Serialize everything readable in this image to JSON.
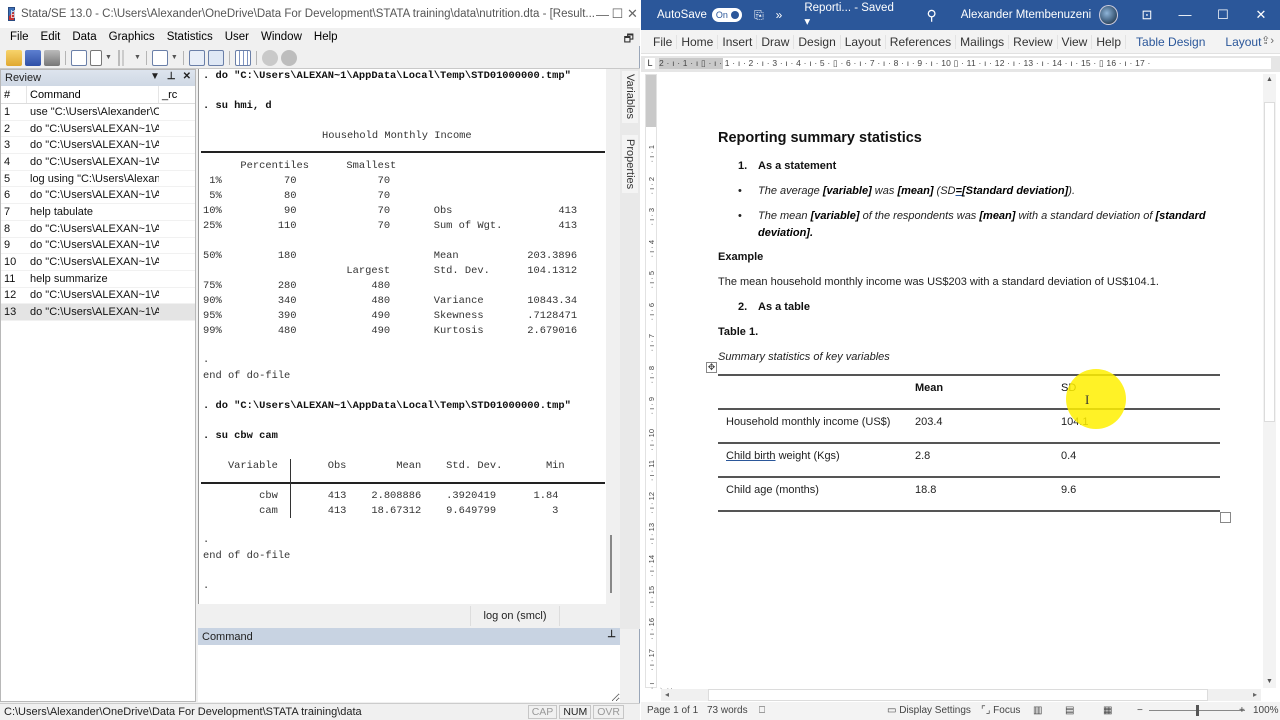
{
  "stata": {
    "title": "Stata/SE 13.0 - C:\\Users\\Alexander\\OneDrive\\Data For Development\\STATA training\\data\\nutrition.dta - [Result...",
    "window_controls": {
      "minimize": "—",
      "maximize": "☐",
      "close": "✕"
    },
    "menu": [
      "File",
      "Edit",
      "Data",
      "Graphics",
      "Statistics",
      "User",
      "Window",
      "Help"
    ],
    "toolbar_icons": [
      "open-icon",
      "save-icon",
      "print-icon",
      "log-icon",
      "viewer-icon",
      "graph-icon",
      "do-file-editor-icon",
      "data-editor-icon",
      "data-browser-icon",
      "variables-manager-icon",
      "more-icon",
      "break-icon"
    ],
    "review": {
      "title": "Review",
      "columns": [
        "#",
        "Command",
        "_rc"
      ],
      "rows": [
        {
          "n": "1",
          "cmd": "use \"C:\\Users\\Alexander\\O..."
        },
        {
          "n": "2",
          "cmd": "do \"C:\\Users\\ALEXAN~1\\A..."
        },
        {
          "n": "3",
          "cmd": "do \"C:\\Users\\ALEXAN~1\\A..."
        },
        {
          "n": "4",
          "cmd": "do \"C:\\Users\\ALEXAN~1\\A..."
        },
        {
          "n": "5",
          "cmd": "log using \"C:\\Users\\Alexan..."
        },
        {
          "n": "6",
          "cmd": "do \"C:\\Users\\ALEXAN~1\\A..."
        },
        {
          "n": "7",
          "cmd": "help tabulate"
        },
        {
          "n": "8",
          "cmd": "do \"C:\\Users\\ALEXAN~1\\A..."
        },
        {
          "n": "9",
          "cmd": "do \"C:\\Users\\ALEXAN~1\\A..."
        },
        {
          "n": "10",
          "cmd": "do \"C:\\Users\\ALEXAN~1\\A..."
        },
        {
          "n": "11",
          "cmd": "help summarize"
        },
        {
          "n": "12",
          "cmd": "do \"C:\\Users\\ALEXAN~1\\A..."
        },
        {
          "n": "13",
          "cmd": "do \"C:\\Users\\ALEXAN~1\\A..."
        }
      ],
      "selected_row": "13"
    },
    "results": {
      "cmd1": ". do \"C:\\Users\\ALEXAN~1\\AppData\\Local\\Temp\\STD01000000.tmp\"",
      "cmd2": ". su hmi, d",
      "hmi_title": "Household Monthly Income",
      "hmi_header": "      Percentiles      Smallest",
      "hmi_rows": [
        " 1%          70             70",
        " 5%          80             70",
        "10%          90             70       Obs                 413",
        "25%         110             70       Sum of Wgt.         413",
        "",
        "50%         180                      Mean           203.3896",
        "                       Largest       Std. Dev.      104.1312",
        "75%         280            480",
        "90%         340            480       Variance       10843.34",
        "95%         390            490       Skewness       .7128471",
        "99%         480            490       Kurtosis       2.679016"
      ],
      "dot": ".",
      "end": "end of do-file",
      "cmd3": ". do \"C:\\Users\\ALEXAN~1\\AppData\\Local\\Temp\\STD01000000.tmp\"",
      "cmd4": ". su cbw cam",
      "su_header": "    Variable        Obs        Mean    Std. Dev.       Min",
      "su_rows": [
        "         cbw        413    2.808886    .3920419      1.84",
        "         cam        413    18.67312    9.649799         3"
      ],
      "dot2": ".",
      "end2": "end of do-file",
      "prompt": "."
    },
    "side_tabs": [
      "Variables",
      "Properties"
    ],
    "log_status": "log on (smcl)",
    "command_panel": {
      "title": "Command",
      "value": ""
    },
    "status_path": "C:\\Users\\Alexander\\OneDrive\\Data For Development\\STATA training\\data",
    "keys": [
      {
        "label": "CAP",
        "on": false
      },
      {
        "label": "NUM",
        "on": true
      },
      {
        "label": "OVR",
        "on": false
      }
    ]
  },
  "word": {
    "autosave_label": "AutoSave",
    "autosave_state": "On",
    "doc_title": "Reporti...  - Saved",
    "user": "Alexander Mtembenuzeni",
    "window_controls": {
      "ribbon_display": "⊡",
      "minimize": "—",
      "maximize": "☐",
      "close": "✕"
    },
    "ribbon_tabs": [
      "File",
      "Home",
      "Insert",
      "Draw",
      "Design",
      "Layout",
      "References",
      "Mailings",
      "Review",
      "View",
      "Help"
    ],
    "context_tabs": [
      "Table Design",
      "Layout"
    ],
    "ruler_ticks": "2 · ı · 1 · ı ▯ · ı · 1 · ı · 2 · ı · 3 · ı · 4 · ı · 5 · ▯ · 6 · ı · 7 · ı · 8 · ı · 9 · ı · 10 ▯ · 11 · ı · 12 · ı · 13 · ı · 14 · ı · 15 · ▯ 16 · ı · 17 ·",
    "document": {
      "heading": "Reporting summary statistics",
      "list1_num": "1.",
      "list1": "As a statement",
      "bullet1": {
        "a": "The average ",
        "b": "[variable]",
        "c": " was ",
        "d": "[mean]",
        "e": " (SD",
        "f": "=",
        "g": "[Standard deviation]",
        "h": ")."
      },
      "bullet2": {
        "a": "The mean ",
        "b": "[variable]",
        "c": " of the respondents was ",
        "d": "[mean]",
        "e": " with a standard deviation of ",
        "f": "[standard deviation]."
      },
      "example_label": "Example",
      "example_text": "The mean household monthly income was US$203 with a standard deviation of US$104.1.",
      "list2_num": "2.",
      "list2": "As a table",
      "table_label": "Table 1.",
      "table_caption": "Summary statistics of key variables",
      "table": {
        "headers": [
          "",
          "Mean",
          "SD"
        ],
        "rows": [
          {
            "var": "Household monthly income (US$)",
            "mean": "203.4",
            "sd": "104.1"
          },
          {
            "var_a": "Child birth",
            "var_b": " weight (Kgs)",
            "mean": "2.8",
            "sd": "0.4"
          },
          {
            "var": "Child age (months)",
            "mean": "18.8",
            "sd": "9.6"
          }
        ]
      }
    },
    "status": {
      "page": "Page 1 of 1",
      "words": "73 words",
      "display_settings": "Display Settings",
      "focus": "Focus",
      "zoom_minus": "−",
      "zoom_plus": "+",
      "zoom": "100%"
    }
  }
}
